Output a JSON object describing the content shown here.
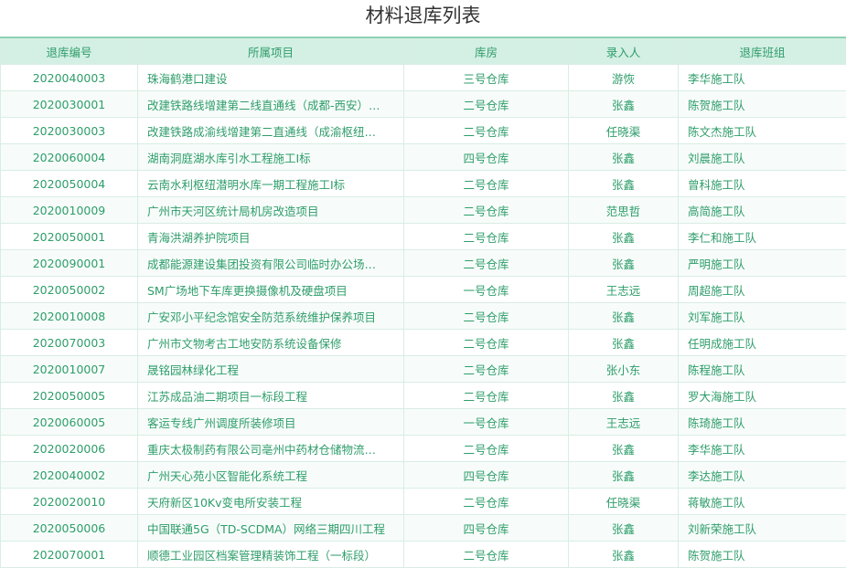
{
  "page": {
    "title": "材料退库列表"
  },
  "table": {
    "columns": [
      "退库编号",
      "所属项目",
      "库房",
      "录入人",
      "退库班组"
    ],
    "rows": [
      [
        "2020040003",
        "珠海鹤港口建设",
        "三号仓库",
        "游恢",
        "李华施工队"
      ],
      [
        "2020030001",
        "改建铁路线增建第二线直通线（成都-西安）…",
        "二号仓库",
        "张鑫",
        "陈贺施工队"
      ],
      [
        "2020030003",
        "改建铁路成渝线增建第二直通线（成渝枢纽…",
        "二号仓库",
        "任晓渠",
        "陈文杰施工队"
      ],
      [
        "2020060004",
        "湖南洞庭湖水库引水工程施工I标",
        "四号仓库",
        "张鑫",
        "刘晨施工队"
      ],
      [
        "2020050004",
        "云南水利枢纽潜明水库一期工程施工I标",
        "二号仓库",
        "张鑫",
        "曾科施工队"
      ],
      [
        "2020010009",
        "广州市天河区统计局机房改造项目",
        "二号仓库",
        "范思哲",
        "高简施工队"
      ],
      [
        "2020050001",
        "青海洪湖养护院项目",
        "二号仓库",
        "张鑫",
        "李仁和施工队"
      ],
      [
        "2020090001",
        "成都能源建设集团投资有限公司临时办公场…",
        "二号仓库",
        "张鑫",
        "严明施工队"
      ],
      [
        "2020050002",
        "SM广场地下车库更换摄像机及硬盘项目",
        "一号仓库",
        "王志远",
        "周超施工队"
      ],
      [
        "2020010008",
        "广安邓小平纪念馆安全防范系统维护保养项目",
        "二号仓库",
        "张鑫",
        "刘军施工队"
      ],
      [
        "2020070003",
        "广州市文物考古工地安防系统设备保修",
        "二号仓库",
        "张鑫",
        "任明成施工队"
      ],
      [
        "2020010007",
        "晟铭园林绿化工程",
        "二号仓库",
        "张小东",
        "陈程施工队"
      ],
      [
        "2020050005",
        "江苏成品油二期项目一标段工程",
        "二号仓库",
        "张鑫",
        "罗大海施工队"
      ],
      [
        "2020060005",
        "客运专线广州调度所装修项目",
        "一号仓库",
        "王志远",
        "陈琦施工队"
      ],
      [
        "2020020006",
        "重庆太极制药有限公司亳州中药材仓储物流…",
        "二号仓库",
        "张鑫",
        "李华施工队"
      ],
      [
        "2020040002",
        "广州天心苑小区智能化系统工程",
        "四号仓库",
        "张鑫",
        "李达施工队"
      ],
      [
        "2020020010",
        "天府新区10Kv变电所安装工程",
        "二号仓库",
        "任晓渠",
        "蒋敏施工队"
      ],
      [
        "2020050006",
        "中国联通5G（TD-SCDMA）网络三期四川工程",
        "四号仓库",
        "张鑫",
        "刘新荣施工队"
      ],
      [
        "2020070001",
        "顺德工业园区档案管理精装饰工程（一标段）",
        "二号仓库",
        "张鑫",
        "陈贺施工队"
      ]
    ]
  }
}
